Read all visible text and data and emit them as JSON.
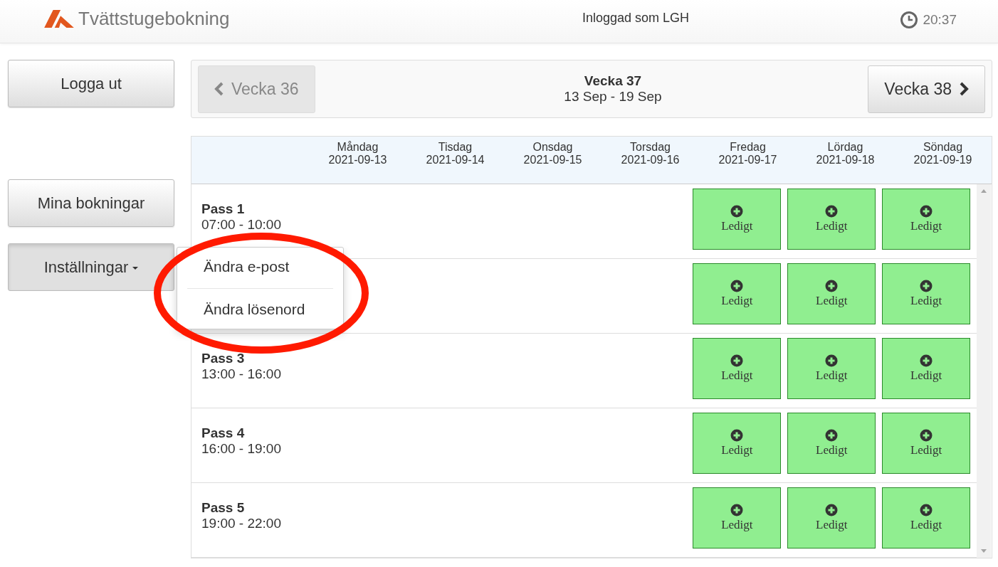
{
  "header": {
    "app_title": "Tvättstugebokning",
    "user_label": "Inloggad som LGH",
    "time": "20:37"
  },
  "sidebar": {
    "buttons": [
      {
        "label": "Logga ut",
        "kind": "button"
      },
      {
        "label": "Mina bokningar",
        "kind": "button"
      },
      {
        "label": "Inställningar",
        "kind": "dropdown",
        "expanded": true
      }
    ]
  },
  "dropdown_menu": [
    {
      "label": "Ändra e-post"
    },
    {
      "label": "Ändra lösenord"
    }
  ],
  "week_nav": {
    "prev": {
      "label": "Vecka 36",
      "disabled": true
    },
    "current": {
      "title": "Vecka 37",
      "range": "13 Sep - 19 Sep"
    },
    "next": {
      "label": "Vecka 38",
      "disabled": false
    }
  },
  "schedule": {
    "days": [
      {
        "name": "Måndag",
        "date": "2021-09-13"
      },
      {
        "name": "Tisdag",
        "date": "2021-09-14"
      },
      {
        "name": "Onsdag",
        "date": "2021-09-15"
      },
      {
        "name": "Torsdag",
        "date": "2021-09-16"
      },
      {
        "name": "Fredag",
        "date": "2021-09-17"
      },
      {
        "name": "Lördag",
        "date": "2021-09-18"
      },
      {
        "name": "Söndag",
        "date": "2021-09-19"
      }
    ],
    "rows": [
      {
        "label": "Pass 1",
        "time": "07:00 - 10:00",
        "slots": [
          {
            "kind": "empty"
          },
          {
            "kind": "empty"
          },
          {
            "kind": "empty"
          },
          {
            "kind": "empty"
          },
          {
            "kind": "free",
            "label": "Ledigt"
          },
          {
            "kind": "free",
            "label": "Ledigt"
          },
          {
            "kind": "free",
            "label": "Ledigt"
          }
        ]
      },
      {
        "slots": [
          {
            "kind": "empty"
          },
          {
            "kind": "empty"
          },
          {
            "kind": "empty"
          },
          {
            "kind": "empty"
          },
          {
            "kind": "free",
            "label": "Ledigt"
          },
          {
            "kind": "free",
            "label": "Ledigt"
          },
          {
            "kind": "free",
            "label": "Ledigt"
          }
        ]
      },
      {
        "label": "Pass 3",
        "time": "13:00 - 16:00",
        "slots": [
          {
            "kind": "empty"
          },
          {
            "kind": "empty"
          },
          {
            "kind": "empty"
          },
          {
            "kind": "empty"
          },
          {
            "kind": "free",
            "label": "Ledigt"
          },
          {
            "kind": "free",
            "label": "Ledigt"
          },
          {
            "kind": "free",
            "label": "Ledigt"
          }
        ]
      },
      {
        "label": "Pass 4",
        "time": "16:00 - 19:00",
        "slots": [
          {
            "kind": "empty"
          },
          {
            "kind": "empty"
          },
          {
            "kind": "empty"
          },
          {
            "kind": "empty"
          },
          {
            "kind": "free",
            "label": "Ledigt"
          },
          {
            "kind": "free",
            "label": "Ledigt"
          },
          {
            "kind": "free",
            "label": "Ledigt"
          }
        ]
      },
      {
        "label": "Pass 5",
        "time": "19:00 - 22:00",
        "slots": [
          {
            "kind": "empty"
          },
          {
            "kind": "empty"
          },
          {
            "kind": "empty"
          },
          {
            "kind": "empty"
          },
          {
            "kind": "free",
            "label": "Ledigt"
          },
          {
            "kind": "free",
            "label": "Ledigt"
          },
          {
            "kind": "free",
            "label": "Ledigt"
          }
        ]
      }
    ]
  }
}
